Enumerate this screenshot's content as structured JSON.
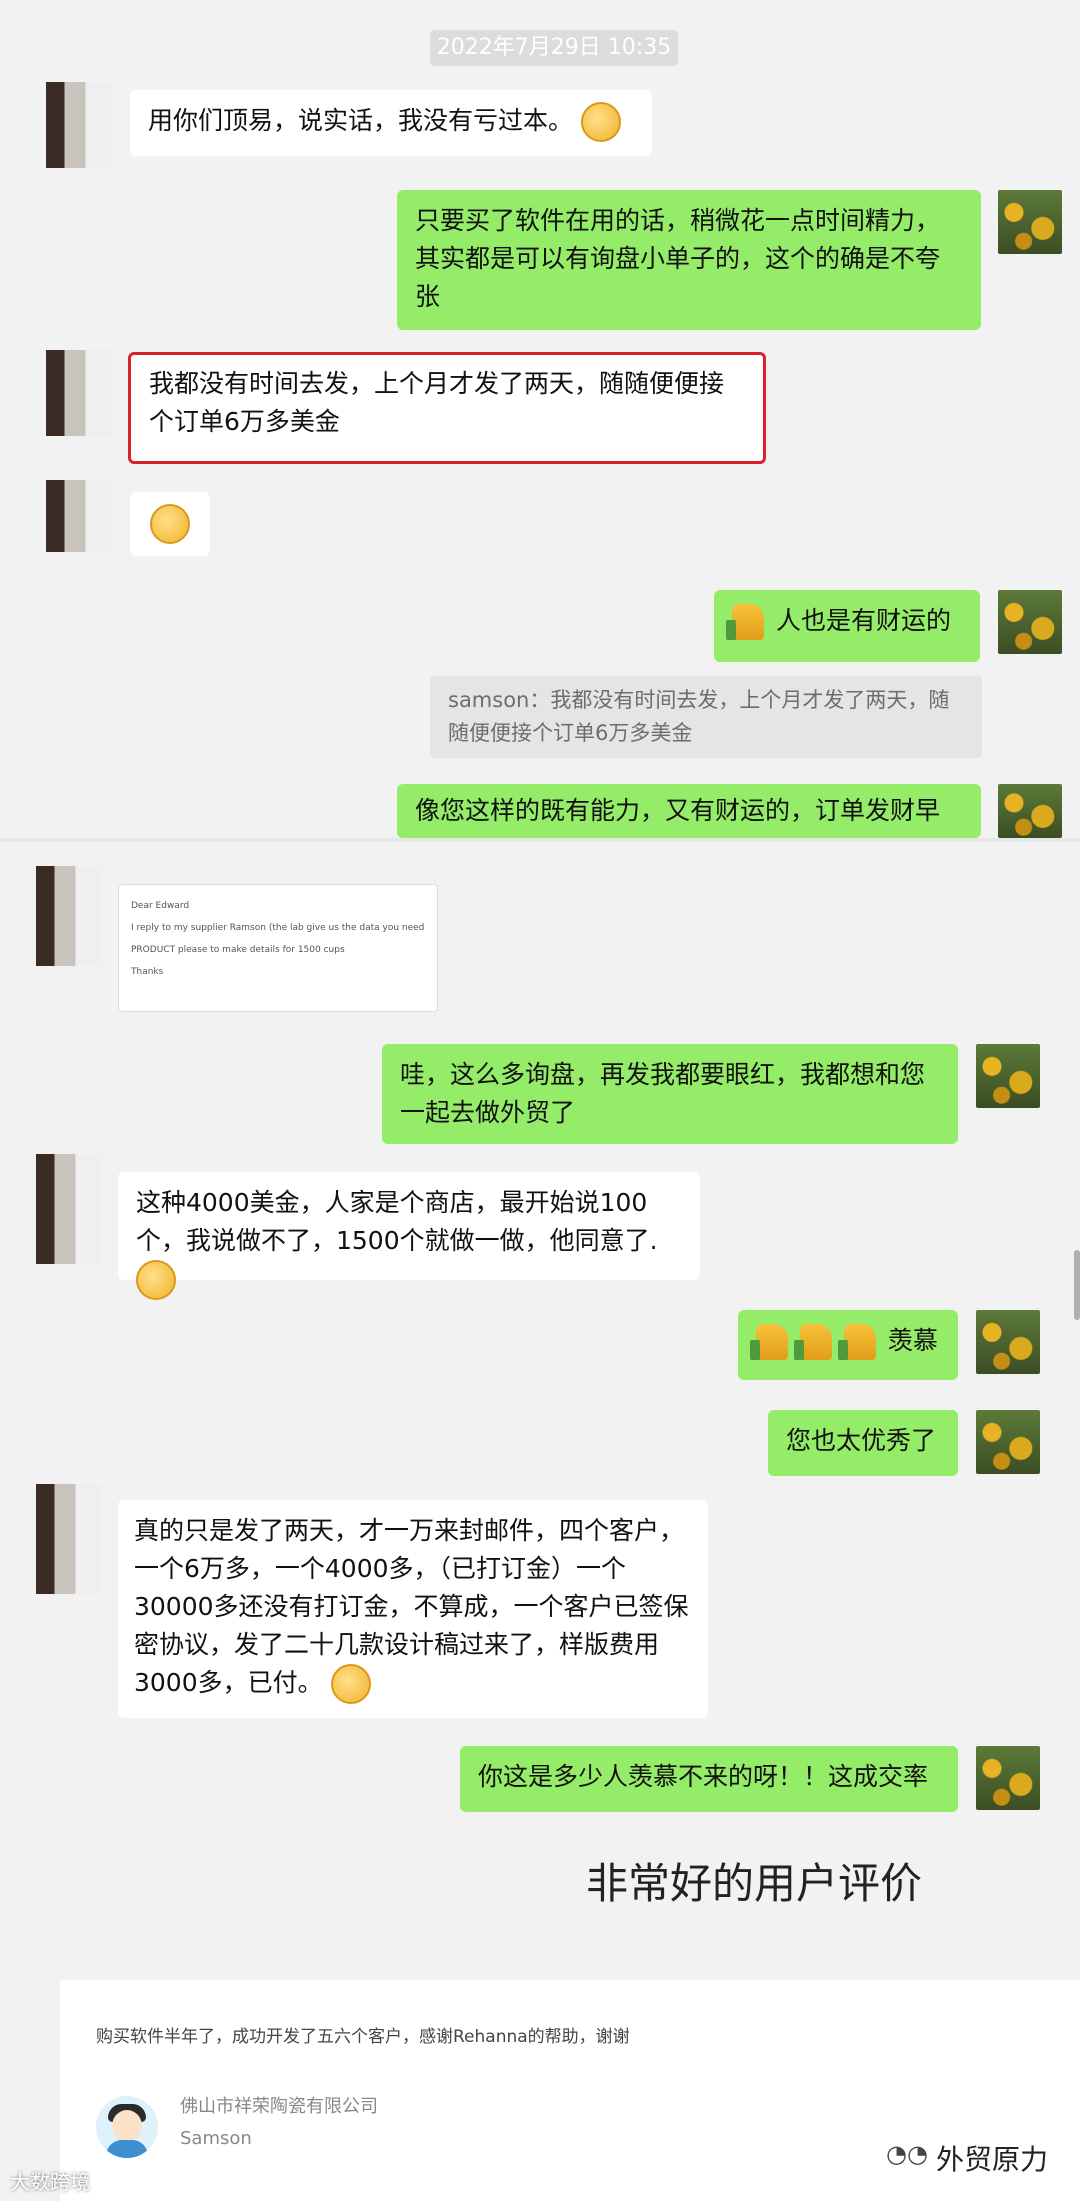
{
  "timestamp": "2022年7月29日 10:35",
  "messages": {
    "m1": "用你们顶易，说实话，我没有亏过本。",
    "m2": "只要买了软件在用的话，稍微花一点时间精力，其实都是可以有询盘小单子的，这个的确是不夸张",
    "m3": "我都没有时间去发，上个月才发了两天，随随便便接个订单6万多美金",
    "m5": "人也是有财运的",
    "quote": "samson：我都没有时间去发，上个月才发了两天，随随便便接个订单6万多美金",
    "m6": "像您这样的既有能力，又有财运的，订单发财早",
    "doc": {
      "line1": "Dear Edward",
      "line2": "I reply to my supplier Ramson (the lab give us the data you need",
      "line3": "PRODUCT please to make details for 1500 cups",
      "line4": "Thanks"
    },
    "m7": "哇，这么多询盘，再发我都要眼红，我都想和您一起去做外贸了",
    "m8": "这种4000美金，人家是个商店，最开始说100个，我说做不了，1500个就做一做，他同意了.",
    "m9": "羡慕",
    "m10": "您也太优秀了",
    "m11": "真的只是发了两天，才一万来封邮件，四个客户，一个6万多，一个4000多，（已打订金）一个30000多还没有打订金，不算成，一个客户已签保密协议，发了二十几款设计稿过来了，样版费用3000多，已付。",
    "m12": "你这是多少人羡慕不来的呀！！这成交率"
  },
  "caption": "非常好的用户评价",
  "review": {
    "text": "购买软件半年了，成功开发了五六个客户，感谢Rehanna的帮助，谢谢",
    "company": "佛山市祥荣陶瓷有限公司",
    "name": "Samson"
  },
  "watermarks": {
    "left": "大数跨境",
    "right": "外贸原力"
  },
  "colors": {
    "outgoing_bubble": "#95ec69",
    "incoming_bubble": "#ffffff",
    "highlight_border": "#d8232a"
  }
}
